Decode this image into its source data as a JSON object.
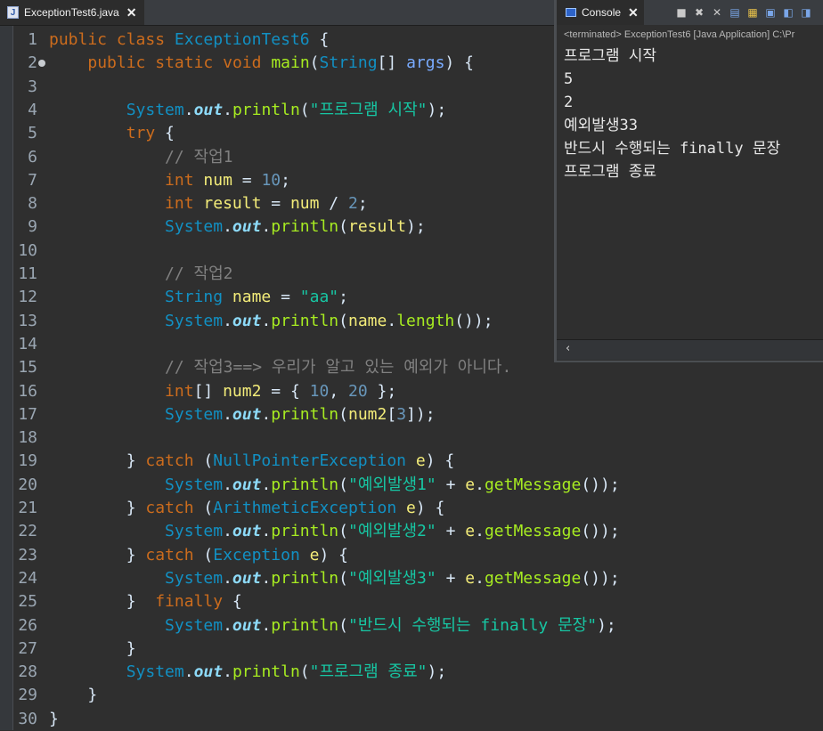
{
  "editor": {
    "tab_title": "ExceptionTest6.java",
    "tab_close": "✕",
    "lines": [
      {
        "n": "1",
        "tokens": [
          [
            "kw",
            "public"
          ],
          [
            "p",
            " "
          ],
          [
            "kw",
            "class"
          ],
          [
            "p",
            " "
          ],
          [
            "ty",
            "ExceptionTest6"
          ],
          [
            "p",
            " {"
          ]
        ]
      },
      {
        "n": "2",
        "tokens": [
          [
            "p",
            "    "
          ],
          [
            "kw",
            "public"
          ],
          [
            "p",
            " "
          ],
          [
            "kw",
            "static"
          ],
          [
            "p",
            " "
          ],
          [
            "kw",
            "void"
          ],
          [
            "p",
            " "
          ],
          [
            "mt",
            "main"
          ],
          [
            "p",
            "("
          ],
          [
            "ty",
            "String"
          ],
          [
            "p",
            "[] "
          ],
          [
            "pa",
            "args"
          ],
          [
            "p",
            ") {"
          ]
        ]
      },
      {
        "n": "3",
        "tokens": []
      },
      {
        "n": "4",
        "tokens": [
          [
            "p",
            "        "
          ],
          [
            "ty",
            "System"
          ],
          [
            "p",
            "."
          ],
          [
            "fd",
            "out"
          ],
          [
            "p",
            "."
          ],
          [
            "mt",
            "println"
          ],
          [
            "p",
            "("
          ],
          [
            "st",
            "\"프로그램 시작\""
          ],
          [
            "p",
            ");"
          ]
        ]
      },
      {
        "n": "5",
        "tokens": [
          [
            "p",
            "        "
          ],
          [
            "kw",
            "try"
          ],
          [
            "p",
            " {"
          ]
        ]
      },
      {
        "n": "6",
        "tokens": [
          [
            "p",
            "            "
          ],
          [
            "cm",
            "// 작업1"
          ]
        ]
      },
      {
        "n": "7",
        "tokens": [
          [
            "p",
            "            "
          ],
          [
            "kw",
            "int"
          ],
          [
            "p",
            " "
          ],
          [
            "va",
            "num"
          ],
          [
            "p",
            " = "
          ],
          [
            "nm",
            "10"
          ],
          [
            "p",
            ";"
          ]
        ]
      },
      {
        "n": "8",
        "tokens": [
          [
            "p",
            "            "
          ],
          [
            "kw",
            "int"
          ],
          [
            "p",
            " "
          ],
          [
            "va",
            "result"
          ],
          [
            "p",
            " = "
          ],
          [
            "va",
            "num"
          ],
          [
            "p",
            " / "
          ],
          [
            "nm",
            "2"
          ],
          [
            "p",
            ";"
          ]
        ]
      },
      {
        "n": "9",
        "tokens": [
          [
            "p",
            "            "
          ],
          [
            "ty",
            "System"
          ],
          [
            "p",
            "."
          ],
          [
            "fd",
            "out"
          ],
          [
            "p",
            "."
          ],
          [
            "mt",
            "println"
          ],
          [
            "p",
            "("
          ],
          [
            "va",
            "result"
          ],
          [
            "p",
            ");"
          ]
        ]
      },
      {
        "n": "10",
        "tokens": []
      },
      {
        "n": "11",
        "tokens": [
          [
            "p",
            "            "
          ],
          [
            "cm",
            "// 작업2"
          ]
        ]
      },
      {
        "n": "12",
        "tokens": [
          [
            "p",
            "            "
          ],
          [
            "ty",
            "String"
          ],
          [
            "p",
            " "
          ],
          [
            "va",
            "name"
          ],
          [
            "p",
            " = "
          ],
          [
            "st",
            "\"aa\""
          ],
          [
            "p",
            ";"
          ]
        ]
      },
      {
        "n": "13",
        "tokens": [
          [
            "p",
            "            "
          ],
          [
            "ty",
            "System"
          ],
          [
            "p",
            "."
          ],
          [
            "fd",
            "out"
          ],
          [
            "p",
            "."
          ],
          [
            "mt",
            "println"
          ],
          [
            "p",
            "("
          ],
          [
            "va",
            "name"
          ],
          [
            "p",
            "."
          ],
          [
            "mt",
            "length"
          ],
          [
            "p",
            "());"
          ]
        ]
      },
      {
        "n": "14",
        "tokens": []
      },
      {
        "n": "15",
        "tokens": [
          [
            "p",
            "            "
          ],
          [
            "cm",
            "// 작업3==> 우리가 알고 있는 예외가 아니다."
          ]
        ]
      },
      {
        "n": "16",
        "tokens": [
          [
            "p",
            "            "
          ],
          [
            "kw",
            "int"
          ],
          [
            "p",
            "[] "
          ],
          [
            "va",
            "num2"
          ],
          [
            "p",
            " = { "
          ],
          [
            "nm",
            "10"
          ],
          [
            "p",
            ", "
          ],
          [
            "nm",
            "20"
          ],
          [
            "p",
            " };"
          ]
        ]
      },
      {
        "n": "17",
        "tokens": [
          [
            "p",
            "            "
          ],
          [
            "ty",
            "System"
          ],
          [
            "p",
            "."
          ],
          [
            "fd",
            "out"
          ],
          [
            "p",
            "."
          ],
          [
            "mt",
            "println"
          ],
          [
            "p",
            "("
          ],
          [
            "va",
            "num2"
          ],
          [
            "p",
            "["
          ],
          [
            "nm",
            "3"
          ],
          [
            "p",
            "]);"
          ]
        ]
      },
      {
        "n": "18",
        "tokens": []
      },
      {
        "n": "19",
        "tokens": [
          [
            "p",
            "        } "
          ],
          [
            "kw",
            "catch"
          ],
          [
            "p",
            " ("
          ],
          [
            "ty",
            "NullPointerException"
          ],
          [
            "p",
            " "
          ],
          [
            "va",
            "e"
          ],
          [
            "p",
            ") {"
          ]
        ]
      },
      {
        "n": "20",
        "tokens": [
          [
            "p",
            "            "
          ],
          [
            "ty",
            "System"
          ],
          [
            "p",
            "."
          ],
          [
            "fd",
            "out"
          ],
          [
            "p",
            "."
          ],
          [
            "mt",
            "println"
          ],
          [
            "p",
            "("
          ],
          [
            "st",
            "\"예외발생1\""
          ],
          [
            "p",
            " + "
          ],
          [
            "va",
            "e"
          ],
          [
            "p",
            "."
          ],
          [
            "mt",
            "getMessage"
          ],
          [
            "p",
            "());"
          ]
        ]
      },
      {
        "n": "21",
        "tokens": [
          [
            "p",
            "        } "
          ],
          [
            "kw",
            "catch"
          ],
          [
            "p",
            " ("
          ],
          [
            "ty",
            "ArithmeticException"
          ],
          [
            "p",
            " "
          ],
          [
            "va",
            "e"
          ],
          [
            "p",
            ") {"
          ]
        ]
      },
      {
        "n": "22",
        "tokens": [
          [
            "p",
            "            "
          ],
          [
            "ty",
            "System"
          ],
          [
            "p",
            "."
          ],
          [
            "fd",
            "out"
          ],
          [
            "p",
            "."
          ],
          [
            "mt",
            "println"
          ],
          [
            "p",
            "("
          ],
          [
            "st",
            "\"예외발생2\""
          ],
          [
            "p",
            " + "
          ],
          [
            "va",
            "e"
          ],
          [
            "p",
            "."
          ],
          [
            "mt",
            "getMessage"
          ],
          [
            "p",
            "());"
          ]
        ]
      },
      {
        "n": "23",
        "tokens": [
          [
            "p",
            "        } "
          ],
          [
            "kw",
            "catch"
          ],
          [
            "p",
            " ("
          ],
          [
            "ty",
            "Exception"
          ],
          [
            "p",
            " "
          ],
          [
            "va",
            "e"
          ],
          [
            "p",
            ") {"
          ]
        ]
      },
      {
        "n": "24",
        "tokens": [
          [
            "p",
            "            "
          ],
          [
            "ty",
            "System"
          ],
          [
            "p",
            "."
          ],
          [
            "fd",
            "out"
          ],
          [
            "p",
            "."
          ],
          [
            "mt",
            "println"
          ],
          [
            "p",
            "("
          ],
          [
            "st",
            "\"예외발생3\""
          ],
          [
            "p",
            " + "
          ],
          [
            "va",
            "e"
          ],
          [
            "p",
            "."
          ],
          [
            "mt",
            "getMessage"
          ],
          [
            "p",
            "());"
          ]
        ]
      },
      {
        "n": "25",
        "tokens": [
          [
            "p",
            "        }  "
          ],
          [
            "kw",
            "finally"
          ],
          [
            "p",
            " {"
          ]
        ]
      },
      {
        "n": "26",
        "tokens": [
          [
            "p",
            "            "
          ],
          [
            "ty",
            "System"
          ],
          [
            "p",
            "."
          ],
          [
            "fd",
            "out"
          ],
          [
            "p",
            "."
          ],
          [
            "mt",
            "println"
          ],
          [
            "p",
            "("
          ],
          [
            "st",
            "\"반드시 수행되는 finally 문장\""
          ],
          [
            "p",
            ");"
          ]
        ]
      },
      {
        "n": "27",
        "tokens": [
          [
            "p",
            "        }"
          ]
        ]
      },
      {
        "n": "28",
        "tokens": [
          [
            "p",
            "        "
          ],
          [
            "ty",
            "System"
          ],
          [
            "p",
            "."
          ],
          [
            "fd",
            "out"
          ],
          [
            "p",
            "."
          ],
          [
            "mt",
            "println"
          ],
          [
            "p",
            "("
          ],
          [
            "st",
            "\"프로그램 종료\""
          ],
          [
            "p",
            ");"
          ]
        ]
      },
      {
        "n": "29",
        "tokens": [
          [
            "p",
            "    }"
          ]
        ]
      },
      {
        "n": "30",
        "tokens": [
          [
            "p",
            "}"
          ]
        ]
      }
    ]
  },
  "console": {
    "tab_title": "Console",
    "tab_close": "✕",
    "status": "<terminated> ExceptionTest6 [Java Application] C:\\Pr",
    "output": [
      "프로그램 시작",
      "5",
      "2",
      "예외발생33",
      "반드시 수행되는 finally 문장",
      "프로그램 종료"
    ],
    "scroll_left": "‹"
  },
  "icons": {
    "java_file": "java-file-icon",
    "console": "console-icon",
    "toolbar": [
      "terminate-icon",
      "remove-launch-icon",
      "remove-all-icon",
      "scroll-lock-icon",
      "word-wrap-icon",
      "pin-console-icon",
      "display-selected-icon",
      "open-console-icon"
    ]
  }
}
